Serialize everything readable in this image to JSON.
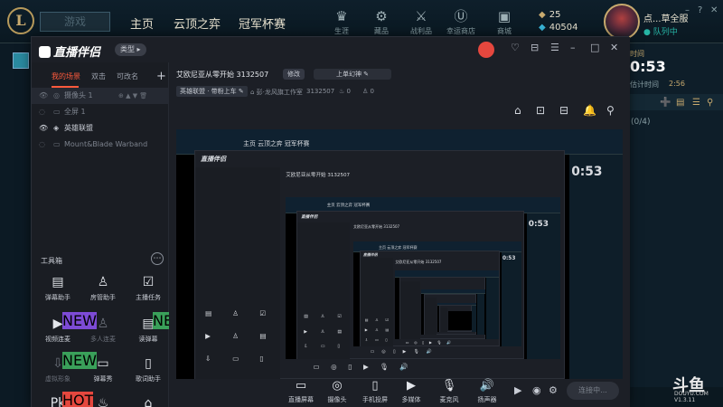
{
  "lol": {
    "play_label": "游戏",
    "nav": [
      "主页",
      "云顶之弈",
      "冠军杯赛"
    ],
    "icons": [
      {
        "label": "生涯",
        "icon": "profile-icon",
        "glyph": "♛"
      },
      {
        "label": "藏品",
        "icon": "collection-icon",
        "glyph": "⚙"
      },
      {
        "label": "战利品",
        "icon": "loot-icon",
        "glyph": "⚔"
      },
      {
        "label": "幸运商店",
        "icon": "lucky-shop-icon",
        "glyph": "Ⓤ"
      },
      {
        "label": "商城",
        "icon": "store-icon",
        "glyph": "▣"
      }
    ],
    "rp": "25",
    "be": "40504",
    "username": "点...草全服",
    "status": "队列中",
    "queue_time": "0:53",
    "queue_label": "估计时间",
    "queue_est": "2:56",
    "queue_header": "时间",
    "friend_count": "(0/4)",
    "window_controls": [
      "–",
      "?",
      "✕"
    ]
  },
  "app": {
    "title": "直播伴侣",
    "badge": "类型",
    "window_controls": [
      "♡",
      "⊟",
      "☰",
      "–",
      "□",
      "✕"
    ],
    "scene_tabs": [
      "我的场景",
      "双击",
      "可改名"
    ],
    "add_scene": "+",
    "sources": [
      {
        "name": "摄像头 1",
        "kind": "◎",
        "selected": true
      },
      {
        "name": "全屏 1",
        "kind": "▭",
        "selected": false
      },
      {
        "name": "英雄联盟",
        "kind": "◈",
        "selected": false
      },
      {
        "name": "Mount&Blade Warband",
        "kind": "▭",
        "selected": false
      }
    ],
    "source_controls": "⊕ ▲ ▼ 🗑",
    "toolbox_title": "工具箱",
    "toolbox_more": "⋯",
    "tools": [
      {
        "label": "弹幕助手",
        "glyph": "▤",
        "tag": "",
        "dim": false
      },
      {
        "label": "房管助手",
        "glyph": "♙",
        "tag": "",
        "dim": false
      },
      {
        "label": "主播任务",
        "glyph": "☑",
        "tag": "",
        "dim": false
      },
      {
        "label": "视频连麦",
        "glyph": "▶",
        "tag": "NEW",
        "tag_color": "#7d4bd6",
        "dim": false
      },
      {
        "label": "多人连麦",
        "glyph": "♙",
        "tag": "",
        "dim": true
      },
      {
        "label": "读弹幕",
        "glyph": "▤",
        "tag": "NEW",
        "tag_color": "#3aa05a",
        "dim": false
      },
      {
        "label": "虚拟形象",
        "glyph": "⇩",
        "tag": "NEW",
        "tag_color": "#3aa05a",
        "dim": true
      },
      {
        "label": "弹幕秀",
        "glyph": "▭",
        "tag": "",
        "dim": false
      },
      {
        "label": "歌词助手",
        "glyph": "▯",
        "tag": "",
        "dim": false
      },
      {
        "label": "",
        "glyph": "Pk",
        "tag": "HOT",
        "tag_color": "#e5473e",
        "dim": false
      },
      {
        "label": "",
        "glyph": "♨",
        "tag": "",
        "dim": false
      },
      {
        "label": "",
        "glyph": "⌂",
        "tag": "",
        "dim": false
      }
    ],
    "room_title": "艾欧尼亚从零开始 3132507",
    "edit_label": "修改",
    "mic_label": "上单幻神",
    "category": "英雄联盟 · 带粉上车",
    "studio": "彭·龙风旗工作室",
    "room_id": "3132507",
    "fire_count": "0",
    "viewer_count": "0",
    "main_icons": [
      "⌂",
      "⊡",
      "⊟",
      "🔔",
      "⚲"
    ],
    "bottom": [
      {
        "label": "直播屏幕",
        "glyph": "▭"
      },
      {
        "label": "摄像头",
        "glyph": "◎"
      },
      {
        "label": "手机投屏",
        "glyph": "▯"
      },
      {
        "label": "多媒体",
        "glyph": "▶"
      },
      {
        "label": "麦克风",
        "glyph": "🎙"
      },
      {
        "label": "扬声器",
        "glyph": "🔊"
      }
    ],
    "bottom_side": [
      "▶",
      "◉",
      "⚙"
    ],
    "live_button": "连接中..."
  },
  "douyu": {
    "mark": "斗鱼",
    "domain": "DOUYU.COM",
    "version": "V1.3.11"
  }
}
